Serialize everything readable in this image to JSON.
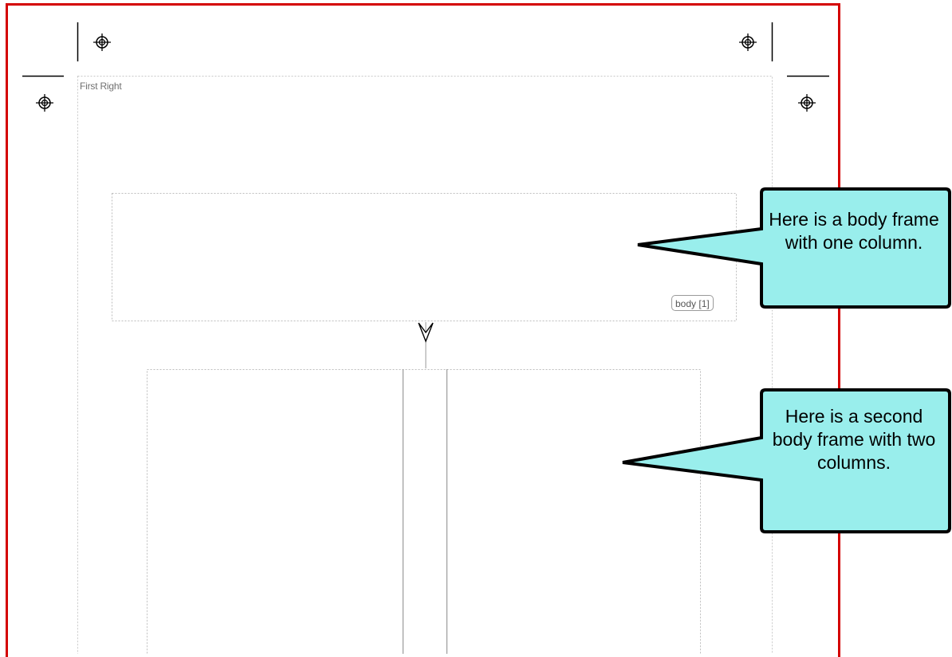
{
  "layout_editor": {
    "page_name": "First Right",
    "frame_tag": "body [1]"
  },
  "callouts": [
    {
      "text": "Here is a body frame with one column."
    },
    {
      "text": "Here is a second body frame with two columns."
    }
  ],
  "colors": {
    "page_border": "#d40000",
    "callout_fill": "#99eeec",
    "frame_outline": "#c0c0c0"
  },
  "icons": {
    "registration_mark": "crosshair-target-icon",
    "frame_link": "chevron-down-arrow-icon"
  }
}
